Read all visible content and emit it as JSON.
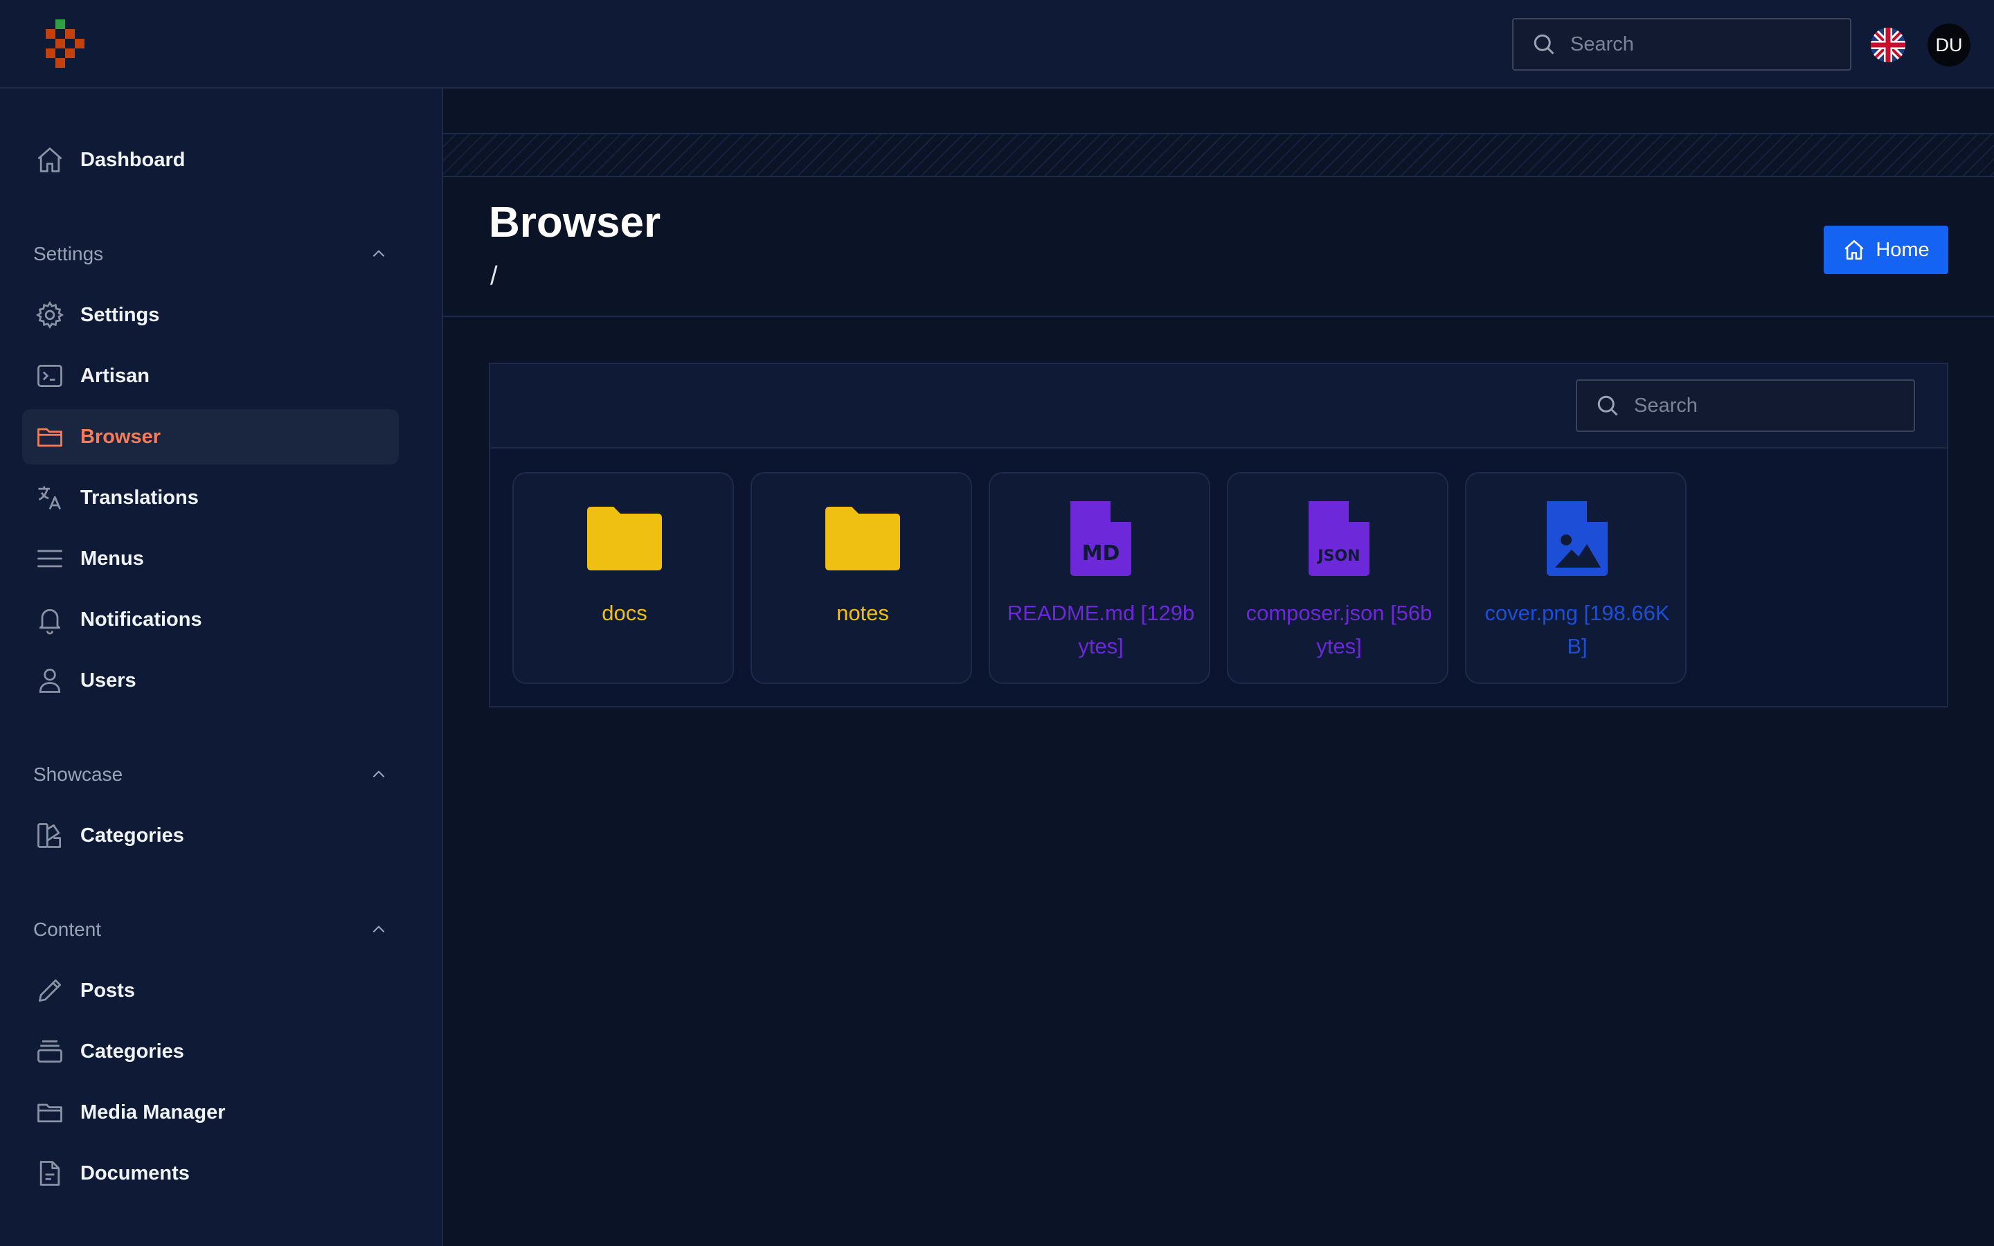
{
  "topbar": {
    "search_placeholder": "Search",
    "avatar_initials": "DU",
    "language_flag": "uk-flag-icon"
  },
  "sidebar": {
    "items": [
      {
        "label": "Dashboard",
        "icon": "home-icon"
      },
      {
        "label": "Settings",
        "icon": "gear-icon"
      },
      {
        "label": "Artisan",
        "icon": "terminal-icon"
      },
      {
        "label": "Browser",
        "icon": "folder-icon",
        "active": true
      },
      {
        "label": "Translations",
        "icon": "language-icon"
      },
      {
        "label": "Menus",
        "icon": "menu-icon"
      },
      {
        "label": "Notifications",
        "icon": "bell-icon"
      },
      {
        "label": "Users",
        "icon": "user-icon"
      },
      {
        "label": "Categories",
        "icon": "swatch-icon"
      },
      {
        "label": "Posts",
        "icon": "pencil-icon"
      },
      {
        "label": "Categories",
        "icon": "stack-icon"
      },
      {
        "label": "Media Manager",
        "icon": "folder-icon"
      },
      {
        "label": "Documents",
        "icon": "document-icon"
      }
    ],
    "groups": [
      {
        "label": "Settings"
      },
      {
        "label": "Showcase"
      },
      {
        "label": "Content"
      }
    ]
  },
  "page": {
    "title": "Browser",
    "breadcrumb": "/",
    "home_button": "Home"
  },
  "panel": {
    "search_placeholder": "Search",
    "files": [
      {
        "label": "docs",
        "type": "folder",
        "icon": "folder-icon",
        "color": "#efc011"
      },
      {
        "label": "notes",
        "type": "folder",
        "icon": "folder-icon",
        "color": "#efc011"
      },
      {
        "label": "README.md [129bytes]",
        "type": "markdown",
        "icon": "markdown-file-icon",
        "badge": "MD",
        "color": "#6d28d9"
      },
      {
        "label": "composer.json [56bytes]",
        "type": "json",
        "icon": "json-file-icon",
        "badge": "JSON",
        "color": "#6d28d9"
      },
      {
        "label": "cover.png [198.66KB]",
        "type": "image",
        "icon": "image-file-icon",
        "color": "#1d4ed8"
      }
    ]
  },
  "colors": {
    "accent": "#f87c56",
    "primary_button": "#1463f3",
    "folder": "#efc011",
    "doc_file": "#6d28d9",
    "image_file": "#1d4ed8"
  }
}
